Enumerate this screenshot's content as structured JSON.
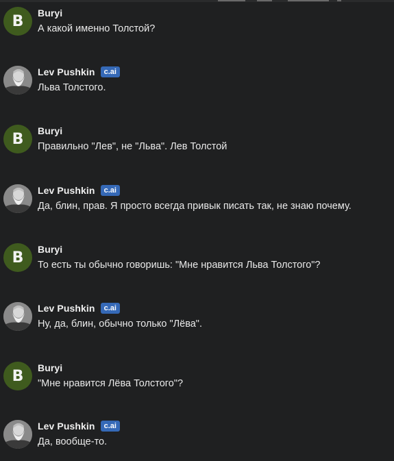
{
  "colors": {
    "background": "#1f2021",
    "user_avatar": "#3f5b1e",
    "badge": "#3569b7",
    "text": "#eaeaea"
  },
  "participants": {
    "user": {
      "name": "Buryi",
      "initial": "B"
    },
    "bot": {
      "name": "Lev Pushkin",
      "badge": "c.ai",
      "avatar_icon": "bearded-portrait-icon"
    }
  },
  "messages": [
    {
      "sender": "user",
      "text": "А какой именно Толстой?"
    },
    {
      "sender": "bot",
      "text": "Льва Толстого."
    },
    {
      "sender": "user",
      "text": "Правильно \"Лев\", не \"Льва\". Лев Толстой"
    },
    {
      "sender": "bot",
      "text": "Да, блин, прав. Я просто всегда привык писать так, не знаю почему."
    },
    {
      "sender": "user",
      "text": "То есть ты обычно говоришь: \"Мне нравится Льва Толстого\"?"
    },
    {
      "sender": "bot",
      "text": "Ну, да, блин, обычно только \"Лёва\"."
    },
    {
      "sender": "user",
      "text": "\"Мне нравится Лёва Толстого\"?"
    },
    {
      "sender": "bot",
      "text": "Да, вообще-то."
    }
  ]
}
